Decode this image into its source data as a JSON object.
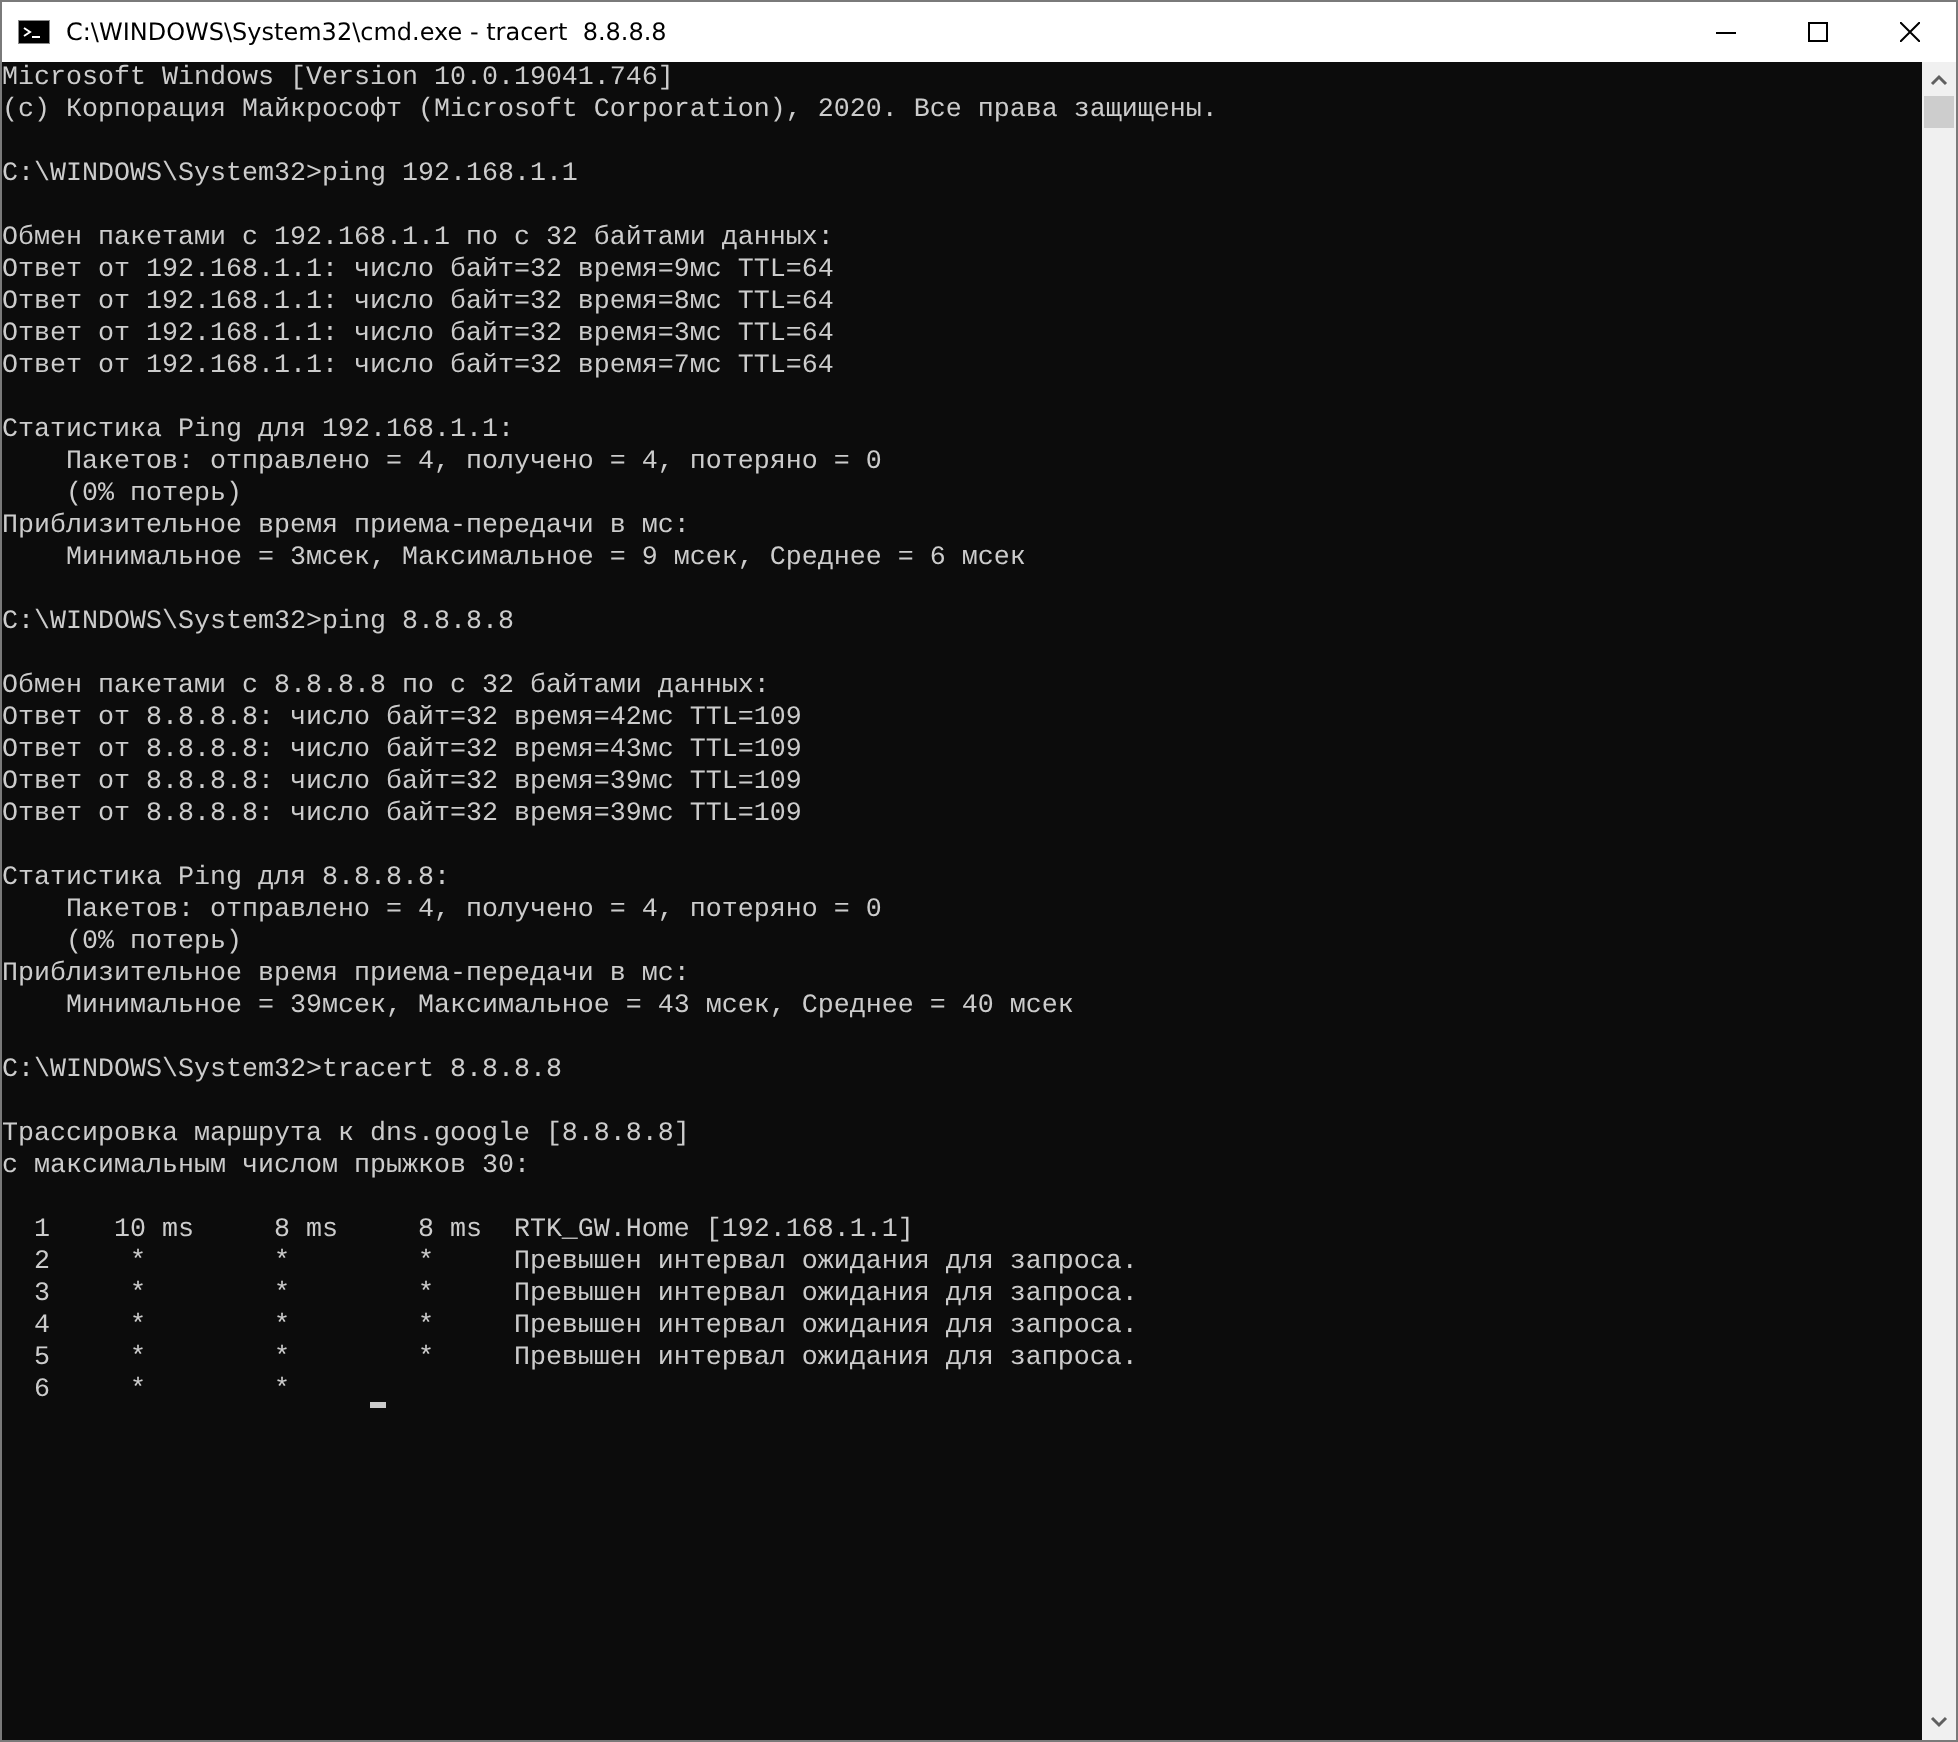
{
  "window": {
    "title": "C:\\WINDOWS\\System32\\cmd.exe - tracert  8.8.8.8"
  },
  "console": {
    "blocks": [
      {
        "lines": [
          "Microsoft Windows [Version 10.0.19041.746]",
          "(c) Корпорация Майкрософт (Microsoft Corporation), 2020. Все права защищены."
        ]
      },
      {
        "lines": [
          "C:\\WINDOWS\\System32>ping 192.168.1.1"
        ]
      },
      {
        "lines": [
          "Обмен пакетами с 192.168.1.1 по с 32 байтами данных:",
          "Ответ от 192.168.1.1: число байт=32 время=9мс TTL=64",
          "Ответ от 192.168.1.1: число байт=32 время=8мс TTL=64",
          "Ответ от 192.168.1.1: число байт=32 время=3мс TTL=64",
          "Ответ от 192.168.1.1: число байт=32 время=7мс TTL=64"
        ]
      },
      {
        "lines": [
          "Статистика Ping для 192.168.1.1:",
          "    Пакетов: отправлено = 4, получено = 4, потеряно = 0",
          "    (0% потерь)",
          "Приблизительное время приема-передачи в мс:",
          "    Минимальное = 3мсек, Максимальное = 9 мсек, Среднее = 6 мсек"
        ]
      },
      {
        "lines": [
          "C:\\WINDOWS\\System32>ping 8.8.8.8"
        ]
      },
      {
        "lines": [
          "Обмен пакетами с 8.8.8.8 по с 32 байтами данных:",
          "Ответ от 8.8.8.8: число байт=32 время=42мс TTL=109",
          "Ответ от 8.8.8.8: число байт=32 время=43мс TTL=109",
          "Ответ от 8.8.8.8: число байт=32 время=39мс TTL=109",
          "Ответ от 8.8.8.8: число байт=32 время=39мс TTL=109"
        ]
      },
      {
        "lines": [
          "Статистика Ping для 8.8.8.8:",
          "    Пакетов: отправлено = 4, получено = 4, потеряно = 0",
          "    (0% потерь)",
          "Приблизительное время приема-передачи в мс:",
          "    Минимальное = 39мсек, Максимальное = 43 мсек, Среднее = 40 мсек"
        ]
      },
      {
        "lines": [
          "C:\\WINDOWS\\System32>tracert 8.8.8.8"
        ]
      },
      {
        "lines": [
          "Трассировка маршрута к dns.google [8.8.8.8]",
          "с максимальным числом прыжков 30:"
        ]
      },
      {
        "lines": [
          "  1    10 ms     8 ms     8 ms  RTK_GW.Home [192.168.1.1]",
          "  2     *        *        *     Превышен интервал ожидания для запроса.",
          "  3     *        *        *     Превышен интервал ожидания для запроса.",
          "  4     *        *        *     Превышен интервал ожидания для запроса.",
          "  5     *        *        *     Превышен интервал ожидания для запроса.",
          "  6     *        *"
        ]
      }
    ],
    "cursor": {
      "visible": true
    }
  }
}
